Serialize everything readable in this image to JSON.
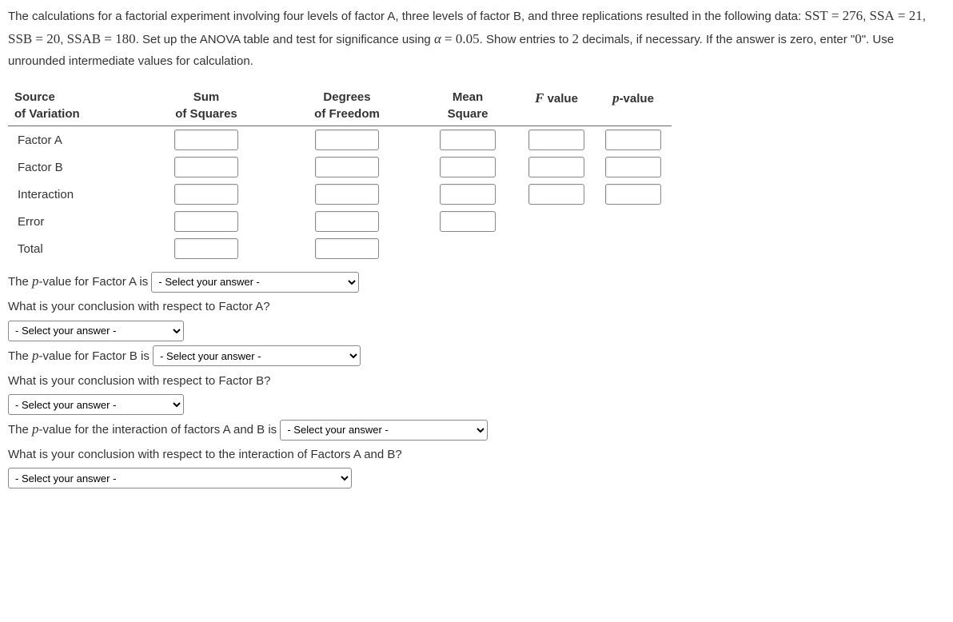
{
  "problem": {
    "s1": "The calculations for a factorial experiment involving four levels of factor A, three levels of factor B, and three replications resulted in the following data: ",
    "eq1_lhs": "SST",
    "eq1_rhs": "276",
    "eq2_lhs": "SSA",
    "eq2_rhs": "21",
    "eq3_lhs": "SSB",
    "eq3_rhs": "20",
    "eq4_lhs": "SSAB",
    "eq4_rhs": "180",
    "s2": ". Set up the ANOVA table and test for significance using ",
    "alpha_sym": "α",
    "alpha_val": "0.05",
    "s3": ". Show entries to ",
    "dec": "2",
    "s4": " decimals, if necessary. If the answer is zero, enter \"",
    "zero": "0",
    "s5": "\". Use unrounded intermediate values for calculation."
  },
  "headers": {
    "source1": "Source",
    "source2": "of Variation",
    "sum1": "Sum",
    "sum2": "of Squares",
    "deg1": "Degrees",
    "deg2": "of Freedom",
    "mean1": "Mean",
    "mean2": "Square",
    "f": "F",
    "f2": " value",
    "p": "p",
    "p2": "-value"
  },
  "rows": {
    "factorA": "Factor A",
    "factorB": "Factor B",
    "interaction": "Interaction",
    "error": "Error",
    "total": "Total"
  },
  "questions": {
    "pA_pre": "The ",
    "pA_var": "p",
    "pA_post": "-value for Factor A is",
    "concA": "What is your conclusion with respect to Factor A?",
    "pB_pre": "The ",
    "pB_var": "p",
    "pB_post": "-value for Factor B is",
    "concB": "What is your conclusion with respect to Factor B?",
    "pAB_pre": "The ",
    "pAB_var": "p",
    "pAB_post": "-value for the interaction of factors A and B is",
    "concAB": "What is your conclusion with respect to the interaction of Factors A and B?"
  },
  "select_placeholder": "- Select your answer -"
}
